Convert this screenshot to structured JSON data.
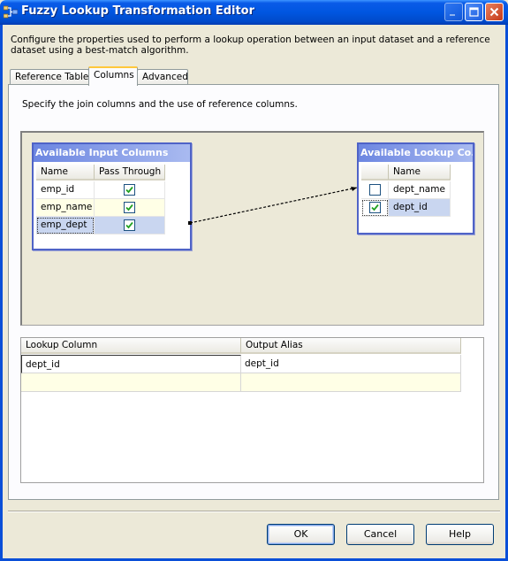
{
  "window": {
    "title": "Fuzzy Lookup Transformation Editor",
    "description": "Configure the properties used to perform a lookup operation between an input dataset and a reference dataset using a best-match algorithm."
  },
  "tabs": [
    {
      "label": "Reference Table",
      "active": false
    },
    {
      "label": "Columns",
      "active": true
    },
    {
      "label": "Advanced",
      "active": false
    }
  ],
  "columns_tab": {
    "instruction": "Specify the join columns and the use of reference columns."
  },
  "input_box": {
    "title": "Available Input Columns",
    "headers": [
      "Name",
      "Pass Through"
    ],
    "rows": [
      {
        "name": "emp_id",
        "pass_through": true
      },
      {
        "name": "emp_name",
        "pass_through": true
      },
      {
        "name": "emp_dept",
        "pass_through": true
      }
    ]
  },
  "lookup_box": {
    "title": "Available Lookup Co...",
    "headers": [
      "",
      "Name"
    ],
    "rows": [
      {
        "checked": false,
        "name": "dept_name"
      },
      {
        "checked": true,
        "name": "dept_id"
      }
    ]
  },
  "output_grid": {
    "headers": [
      "Lookup Column",
      "Output Alias"
    ],
    "rows": [
      {
        "lookup_column": "dept_id",
        "output_alias": "dept_id"
      }
    ]
  },
  "buttons": {
    "ok": "OK",
    "cancel": "Cancel",
    "help": "Help"
  },
  "colors": {
    "titlebar": "#0056E0",
    "box_header": "#6C86E1",
    "selection": "#C9D6F0",
    "new_row": "#FFFFE6"
  }
}
